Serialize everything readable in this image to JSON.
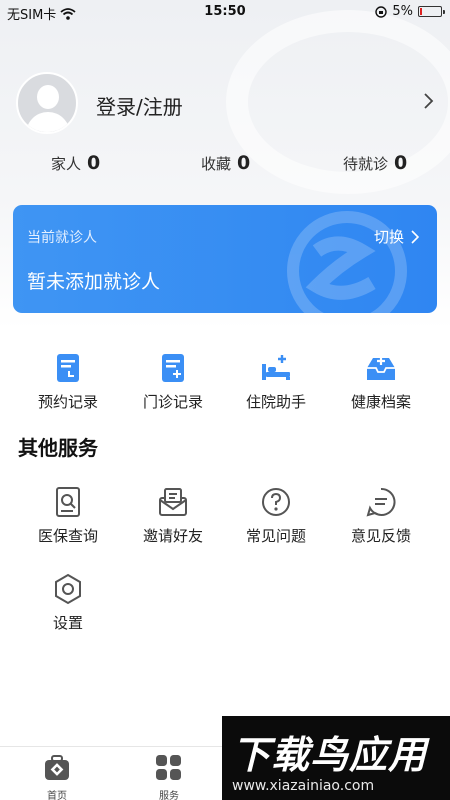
{
  "status_bar": {
    "carrier": "无SIM卡",
    "time": "15:50",
    "battery": "5%"
  },
  "profile": {
    "login_label": "登录/注册"
  },
  "stats": [
    {
      "label": "家人",
      "value": "0"
    },
    {
      "label": "收藏",
      "value": "0"
    },
    {
      "label": "待就诊",
      "value": "0"
    }
  ],
  "patient_card": {
    "label": "当前就诊人",
    "switch_label": "切换",
    "title": "暂未添加就诊人",
    "accent": "#2f86f2"
  },
  "quick_actions": [
    {
      "label": "预约记录",
      "icon": "appointment-record-icon"
    },
    {
      "label": "门诊记录",
      "icon": "outpatient-record-icon"
    },
    {
      "label": "住院助手",
      "icon": "hospital-bed-icon"
    },
    {
      "label": "健康档案",
      "icon": "health-file-icon"
    }
  ],
  "other_services": {
    "title": "其他服务",
    "items": [
      {
        "label": "医保查询",
        "icon": "insurance-search-icon"
      },
      {
        "label": "邀请好友",
        "icon": "invite-envelope-icon"
      },
      {
        "label": "常见问题",
        "icon": "question-icon"
      },
      {
        "label": "意见反馈",
        "icon": "feedback-icon"
      },
      {
        "label": "设置",
        "icon": "settings-hexagon-icon"
      }
    ]
  },
  "tab_bar": [
    {
      "label": "首页",
      "icon": "home-medkit-icon"
    },
    {
      "label": "服务",
      "icon": "service-grid-icon"
    }
  ],
  "watermark": {
    "brand": "下载鸟应用",
    "url": "www.xiazainiao.com"
  }
}
